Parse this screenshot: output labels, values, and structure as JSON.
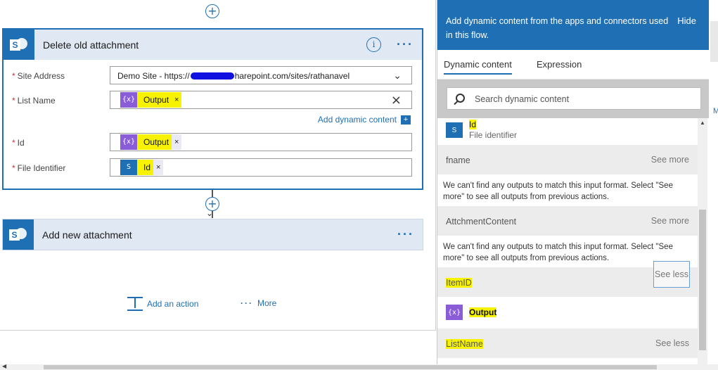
{
  "canvas": {
    "card1": {
      "title": "Delete old attachment",
      "fields": {
        "site_address": {
          "label": "Site Address",
          "value_prefix": "Demo Site - https://",
          "value_suffix": "harepoint.com/sites/rathanavel"
        },
        "list_name": {
          "label": "List Name",
          "token": "Output"
        },
        "id": {
          "label": "Id",
          "token": "Output"
        },
        "file_identifier": {
          "label": "File Identifier",
          "token": "Id"
        }
      },
      "add_dynamic_content": "Add dynamic content"
    },
    "card2": {
      "title": "Add new attachment"
    },
    "add_action": "Add an action",
    "more": "More"
  },
  "panel": {
    "header_message": "Add dynamic content from the apps and connectors used in this flow.",
    "hide": "Hide",
    "tabs": [
      "Dynamic content",
      "Expression"
    ],
    "search_placeholder": "Search dynamic content",
    "top_item": {
      "name": "Id",
      "description": "File identifier"
    },
    "groups": [
      {
        "name": "fname",
        "action": "See more",
        "message": "We can't find any outputs to match this input format. Select \"See more\" to see all outputs from previous actions."
      },
      {
        "name": "AttchmentContent",
        "action": "See more",
        "message": "We can't find any outputs to match this input format. Select \"See more\" to see all outputs from previous actions."
      },
      {
        "name": "ItemID",
        "action": "See less",
        "item": "Output"
      },
      {
        "name": "ListName",
        "action": "See less"
      }
    ]
  },
  "colors": {
    "accent": "#1f6fb5",
    "highlight": "#f7f300",
    "variable": "#8a5cd8"
  },
  "icons": {
    "sharepoint": "sharepoint-icon",
    "variable": "variable-icon"
  }
}
